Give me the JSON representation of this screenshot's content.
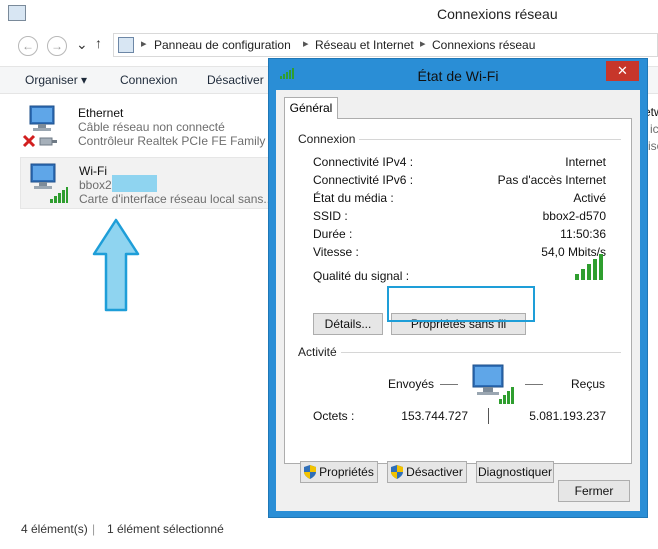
{
  "window": {
    "title": "Connexions réseau"
  },
  "nav": {
    "back": "←",
    "forward": "→",
    "up": "↑"
  },
  "breadcrumb": [
    "Panneau de configuration",
    "Réseau et Internet",
    "Connexions réseau"
  ],
  "commands": {
    "organize": "Organiser ▾",
    "connect": "Connexion",
    "disable": "Désactiver"
  },
  "items": [
    {
      "name": "Ethernet",
      "status": "Câble réseau non connecté",
      "device": "Contrôleur Realtek PCIe FE Family"
    },
    {
      "name": "Wi-Fi",
      "network": "bbox2",
      "device": "Carte d'interface réseau local sans..."
    }
  ],
  "right_peek": {
    "a": "etw",
    "b": "ic",
    "c": "iso"
  },
  "statusbar": {
    "count": "4 élément(s)",
    "selected": "1 élément sélectionné"
  },
  "dialog": {
    "title": "État de Wi-Fi",
    "close": "✕",
    "tab": "Général",
    "connection_group": "Connexion",
    "rows": [
      {
        "label": "Connectivité IPv4 :",
        "value": "Internet"
      },
      {
        "label": "Connectivité IPv6 :",
        "value": "Pas d'accès Internet"
      },
      {
        "label": "État du média :",
        "value": "Activé"
      },
      {
        "label": "SSID :",
        "value": "bbox2-d570"
      },
      {
        "label": "Durée :",
        "value": "11:50:36"
      },
      {
        "label": "Vitesse :",
        "value": "54,0 Mbits/s"
      }
    ],
    "signal_label": "Qualité du signal :",
    "signal_level": 5,
    "details_btn": "Détails...",
    "wireless_props_btn": "Propriétés sans fil",
    "activity_group": "Activité",
    "sent_label": "Envoyés",
    "received_label": "Reçus",
    "bytes_label": "Octets :",
    "bytes_sent": "153.744.727",
    "bytes_received": "5.081.193.237",
    "properties_btn": "Propriétés",
    "disable_btn": "Désactiver",
    "diagnose_btn": "Diagnostiquer",
    "close_btn": "Fermer"
  },
  "colors": {
    "accent": "#2a8ed6",
    "highlight": "#1e9ed8",
    "arrow": "#8fd4f0",
    "signal": "#2f9e2f",
    "close": "#c7362a"
  }
}
